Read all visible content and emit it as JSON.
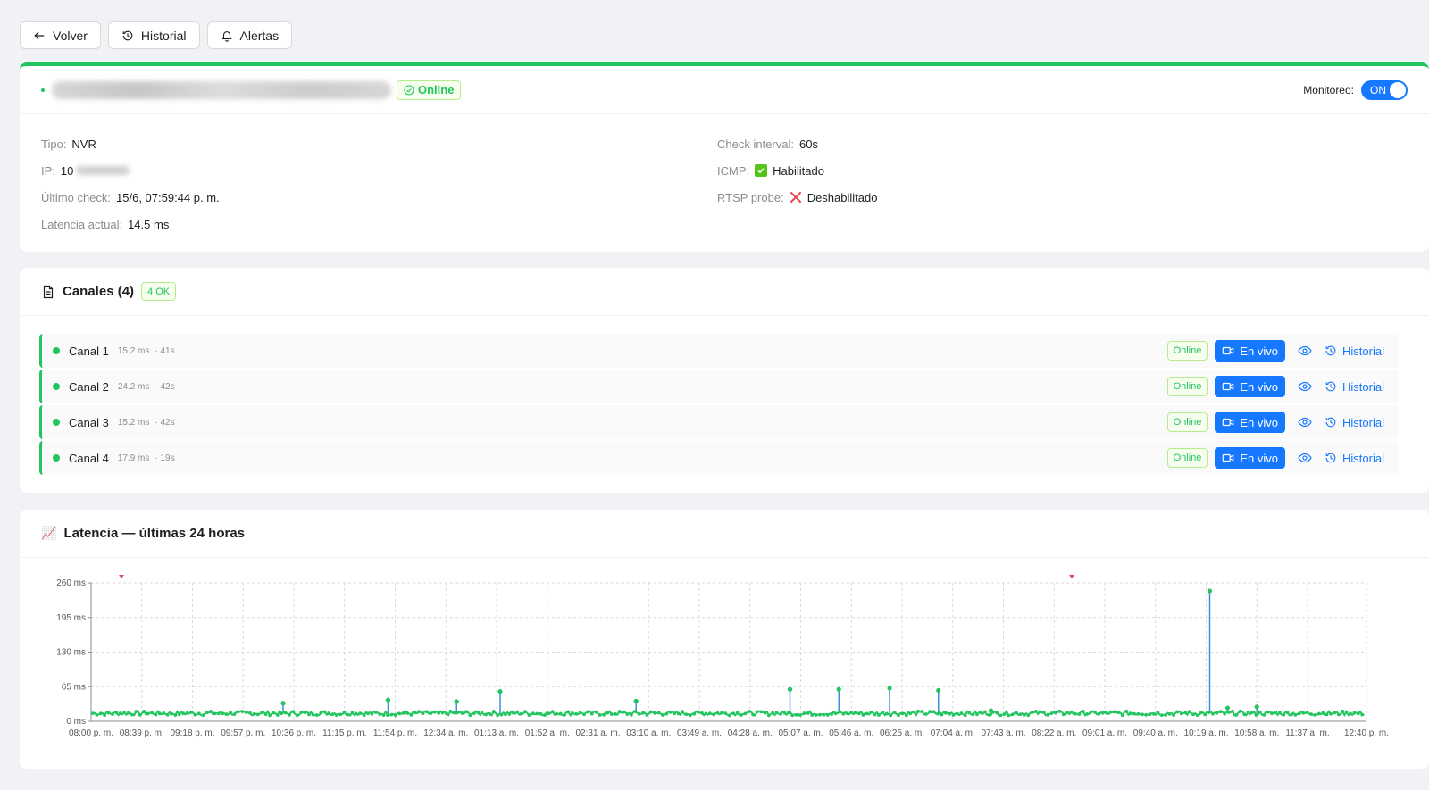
{
  "toolbar": {
    "back": "Volver",
    "history": "Historial",
    "alerts": "Alertas"
  },
  "device": {
    "status": "Online",
    "monitor_label": "Monitoreo:",
    "monitor_state": "ON",
    "fields_left": [
      {
        "key": "Tipo:",
        "value": "NVR"
      },
      {
        "key": "IP:",
        "value": "10"
      },
      {
        "key": "Último check:",
        "value": "15/6, 07:59:44 p. m."
      },
      {
        "key": "Latencia actual:",
        "value": "14.5 ms"
      }
    ],
    "fields_right": [
      {
        "key": "Check interval:",
        "value": "60s"
      },
      {
        "key": "ICMP:",
        "value": "Habilitado"
      },
      {
        "key": "RTSP probe:",
        "value": "Deshabilitado"
      }
    ]
  },
  "channels": {
    "title": "Canales (4)",
    "ok_badge": "4 OK",
    "items": [
      {
        "name": "Canal 1",
        "latency": "15.2 ms",
        "age": "· 41s",
        "status": "Online",
        "live": "En vivo",
        "history": "Historial"
      },
      {
        "name": "Canal 2",
        "latency": "24.2 ms",
        "age": "· 42s",
        "status": "Online",
        "live": "En vivo",
        "history": "Historial"
      },
      {
        "name": "Canal 3",
        "latency": "15.2 ms",
        "age": "· 42s",
        "status": "Online",
        "live": "En vivo",
        "history": "Historial"
      },
      {
        "name": "Canal 4",
        "latency": "17.9 ms",
        "age": "· 19s",
        "status": "Online",
        "live": "En vivo",
        "history": "Historial"
      }
    ]
  },
  "latency": {
    "title": "Latencia — últimas 24 horas",
    "emoji": "📈"
  },
  "chart_data": {
    "type": "line",
    "title": "Latencia — últimas 24 horas",
    "ylim": [
      0,
      260
    ],
    "yticks": [
      "260 ms",
      "195 ms",
      "130 ms",
      "65 ms",
      "0 ms"
    ],
    "ytick_values": [
      260,
      195,
      130,
      65,
      0
    ],
    "xticks": [
      "08:00 p. m.",
      "08:39 p. m.",
      "09:18 p. m.",
      "09:57 p. m.",
      "10:36 p. m.",
      "11:15 p. m.",
      "11:54 p. m.",
      "12:34 a. m.",
      "01:13 a. m.",
      "01:52 a. m.",
      "02:31 a. m.",
      "03:10 a. m.",
      "03:49 a. m.",
      "04:28 a. m.",
      "05:07 a. m.",
      "05:46 a. m.",
      "06:25 a. m.",
      "07:04 a. m.",
      "07:43 a. m.",
      "08:22 a. m.",
      "09:01 a. m.",
      "09:40 a. m.",
      "10:19 a. m.",
      "10:58 a. m.",
      "11:37 a. m.",
      "12:40 p. m."
    ],
    "grid": true,
    "baseline_ms": 15,
    "spikes": [
      {
        "x": "10:36 p. m.",
        "y": 34
      },
      {
        "x": "11:54 p. m.",
        "y": 40
      },
      {
        "x": "12:34 a. m.",
        "y": 37
      },
      {
        "x": "01:13 a. m.",
        "y": 56
      },
      {
        "x": "03:10 a. m.",
        "y": 38
      },
      {
        "x": "05:07 a. m.",
        "y": 60
      },
      {
        "x": "05:46 a. m.",
        "y": 60
      },
      {
        "x": "06:25 a. m.",
        "y": 62
      },
      {
        "x": "07:04 a. m.",
        "y": 58
      },
      {
        "x": "07:43 a. m.",
        "y": 20
      },
      {
        "x": "10:19 a. m.",
        "y": 245
      },
      {
        "x": "10:19 a. m.",
        "y": 25
      },
      {
        "x": "10:58 a. m.",
        "y": 27
      }
    ],
    "series": []
  }
}
